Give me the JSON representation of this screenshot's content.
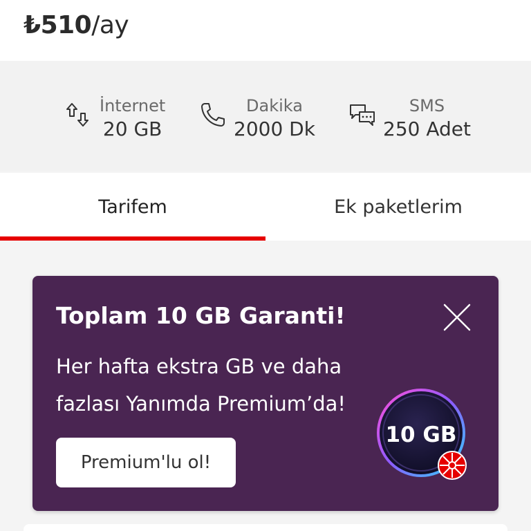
{
  "price": {
    "currency": "₺",
    "amount": "510",
    "period": "/ay"
  },
  "allowances": [
    {
      "label": "İnternet",
      "value": "20 GB",
      "icon": "data-arrows-icon"
    },
    {
      "label": "Dakika",
      "value": "2000 Dk",
      "icon": "phone-icon"
    },
    {
      "label": "SMS",
      "value": "250 Adet",
      "icon": "chat-bubbles-icon"
    }
  ],
  "tabs": [
    {
      "label": "Tarifem",
      "active": true
    },
    {
      "label": "Ek paketlerim",
      "active": false
    }
  ],
  "promo": {
    "title": "Toplam 10 GB Garanti!",
    "description": "Her hafta ekstra GB ve daha fazlası Yanımda Premium’da!",
    "cta_label": "Premium'lu ol!",
    "badge_text": "10 GB",
    "close_icon": "close-icon",
    "background": "#4a2552"
  },
  "colors": {
    "accent": "#e60000"
  }
}
